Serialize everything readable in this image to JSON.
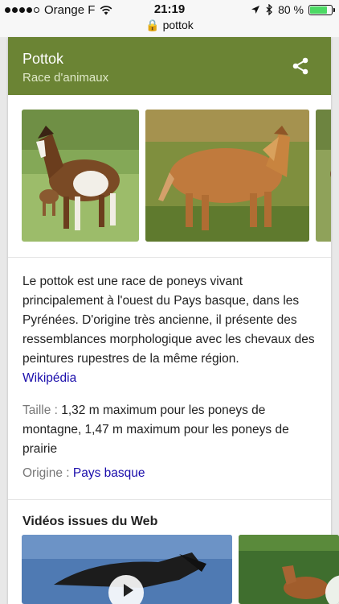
{
  "status": {
    "carrier": "Orange F",
    "time": "21:19",
    "url": "pottok",
    "battery": "80 %",
    "battery_level": 0.8
  },
  "header": {
    "title": "Pottok",
    "subtitle": "Race d'animaux"
  },
  "description": {
    "text": "Le pottok est une race de poneys vivant principalement à l'ouest du Pays basque, dans les Pyrénées. D'origine très ancienne, il présente des ressemblances morphologique avec les chevaux des peintures rupestres de la même région.",
    "source": "Wikipédia"
  },
  "facts": {
    "taille_label": "Taille :",
    "taille_value": "1,32 m maximum pour les poneys de montagne, 1,47 m maximum pour les poneys de prairie",
    "origine_label": "Origine :",
    "origine_value": "Pays basque"
  },
  "videos": {
    "title": "Vidéos issues du Web"
  }
}
